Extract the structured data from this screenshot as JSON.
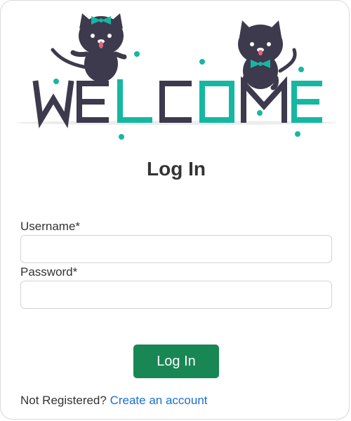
{
  "hero": {
    "welcome_text": "WELCOME"
  },
  "form": {
    "title": "Log In",
    "username_label": "Username*",
    "username_value": "",
    "password_label": "Password*",
    "password_value": "",
    "submit_label": "Log In"
  },
  "footer": {
    "prompt": "Not Registered?",
    "link_label": "Create an account"
  },
  "colors": {
    "accent": "#16b7a2",
    "dark": "#3c3a4c",
    "button": "#198754",
    "link": "#1a6fd1"
  }
}
